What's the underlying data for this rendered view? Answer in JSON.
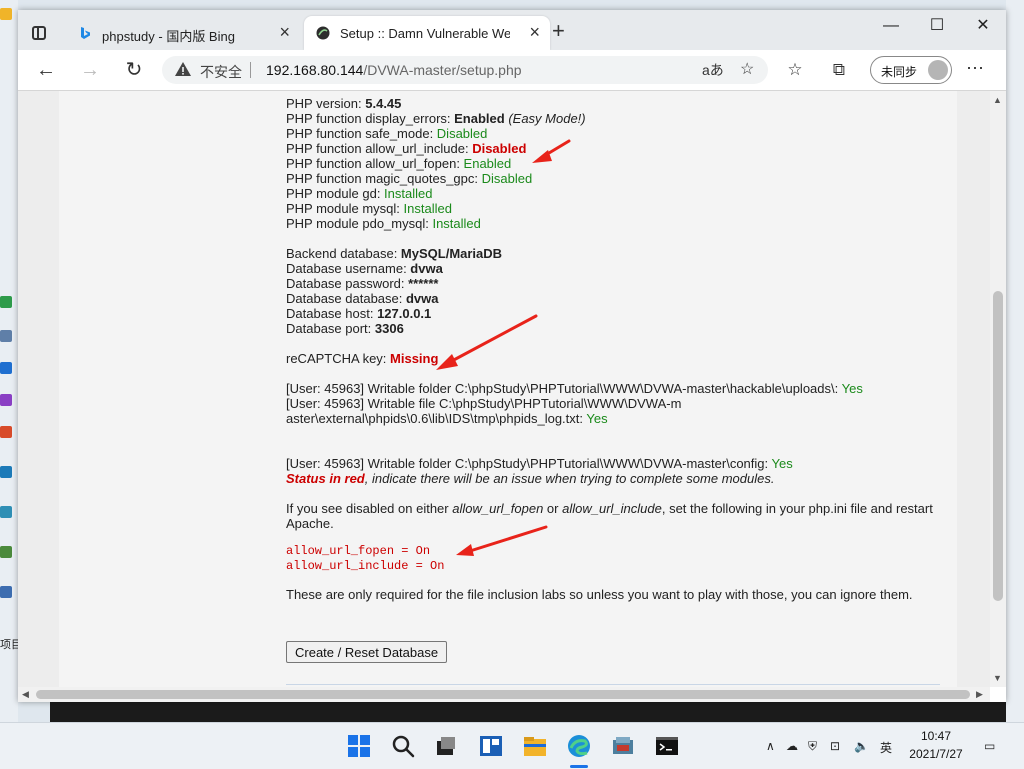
{
  "browser": {
    "tabs": [
      {
        "title": "phpstudy - 国内版 Bing",
        "active": false
      },
      {
        "title": "Setup :: Damn Vulnerable Web App",
        "active": true
      }
    ],
    "address": {
      "security_label": "不安全",
      "host": "192.168.80.144",
      "path": "/DVWA-master/setup.php"
    },
    "profile_label": "未同步",
    "translate_glyph": "aあ"
  },
  "page": {
    "php_version_label": "PHP version: ",
    "php_version": "5.4.45",
    "display_errors_label": "PHP function display_errors: ",
    "display_errors_value": "Enabled",
    "display_errors_note": " (Easy Mode!)",
    "safe_mode_label": "PHP function safe_mode: ",
    "safe_mode_value": "Disabled",
    "allow_url_include_label": "PHP function allow_url_include: ",
    "allow_url_include_value": "Disabled",
    "allow_url_fopen_label": "PHP function allow_url_fopen: ",
    "allow_url_fopen_value": "Enabled",
    "magic_quotes_label": "PHP function magic_quotes_gpc: ",
    "magic_quotes_value": "Disabled",
    "gd_label": "PHP module gd: ",
    "gd_value": "Installed",
    "mysql_label": "PHP module mysql: ",
    "mysql_value": "Installed",
    "pdo_label": "PHP module pdo_mysql: ",
    "pdo_value": "Installed",
    "backend_label": "Backend database: ",
    "backend_value": "MySQL/MariaDB",
    "db_user_label": "Database username: ",
    "db_user_value": "dvwa",
    "db_pass_label": "Database password: ",
    "db_pass_value": "******",
    "db_name_label": "Database database: ",
    "db_name_value": "dvwa",
    "db_host_label": "Database host: ",
    "db_host_value": "127.0.0.1",
    "db_port_label": "Database port: ",
    "db_port_value": "3306",
    "recaptcha_label": "reCAPTCHA key: ",
    "recaptcha_value": "Missing",
    "uploads_text": "[User: 45963] Writable folder C:\\phpStudy\\PHPTutorial\\WWW\\DVWA-master\\hackable\\uploads\\: ",
    "uploads_value": "Yes",
    "phpids_text": "[User: 45963] Writable file C:\\phpStudy\\PHPTutorial\\WWW\\DVWA-master\\external\\phpids\\0.6\\lib\\IDS\\tmp\\phpids_log.txt: ",
    "phpids_value": "Yes",
    "config_text": "[User: 45963] Writable folder C:\\phpStudy\\PHPTutorial\\WWW\\DVWA-master\\config: ",
    "config_value": "Yes",
    "status_red": "Status in red",
    "status_note": ", indicate there will be an issue when trying to complete some modules.",
    "hint_1": "If you see disabled on either ",
    "hint_fopen": "allow_url_fopen",
    "hint_or": " or ",
    "hint_include": "allow_url_include",
    "hint_2": ", set the following in your php.ini file and restart Apache.",
    "code_fopen": "allow_url_fopen = On",
    "code_include": "allow_url_include = On",
    "labs_note": "These are only required for the file inclusion labs so unless you want to play with those, you can ignore them.",
    "reset_button": "Create / Reset Database"
  },
  "taskbar": {
    "time": "10:47",
    "date": "2021/7/27",
    "ime": "英"
  },
  "desktop": {
    "left_text": "项目"
  },
  "colors": {
    "ok_green": "#1b8a1b",
    "error_red": "#cc0000",
    "annotation_red": "#e8231a"
  }
}
